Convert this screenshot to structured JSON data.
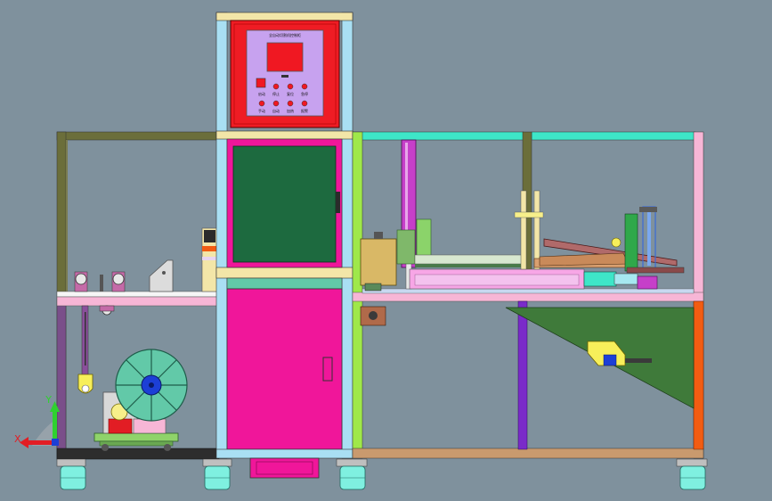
{
  "colors": {
    "background": "#7f919d",
    "frame_olive": "#6b6e3a",
    "frame_pink": "#f7b6d6",
    "frame_light_blue": "#a9dff3",
    "frame_green": "#9fe84a",
    "frame_cyan": "#3ee6c8",
    "control_box": "#ef1c24",
    "control_panel": "#c7a2ef",
    "screen": "#f01822",
    "cabinet_green": "#1d6a3f",
    "cabinet_magenta": "#f0169a",
    "purple_leg": "#7a2bc9",
    "orange_leg": "#f25c12",
    "reel": "#62c9a8",
    "caster": "#7ff0e0",
    "ramp_green": "#3f7a3a"
  },
  "control_panel": {
    "title": "全自动切割机控制柜",
    "button_labels": [
      "启动",
      "停止",
      "复位",
      "急停",
      "手动",
      "自动",
      "加热",
      "报警"
    ]
  },
  "axis_indicator": {
    "x_label": "X",
    "y_label": "Y"
  }
}
